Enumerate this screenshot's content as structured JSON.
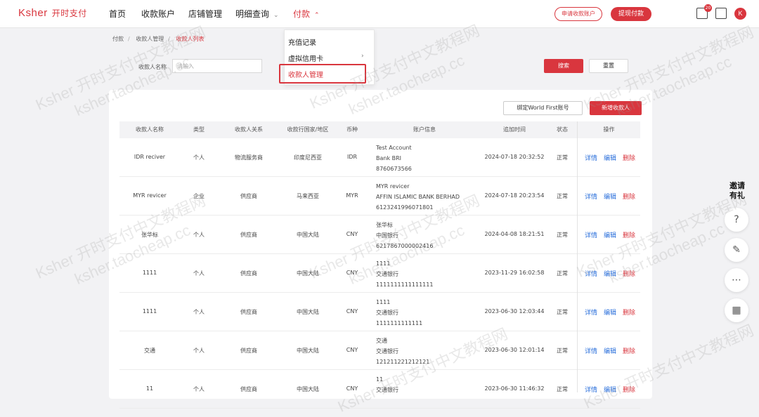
{
  "header": {
    "logo_text": "Ksher",
    "logo_cn": "开时支付",
    "nav": [
      "首页",
      "收款账户",
      "店铺管理",
      "明细查询",
      "付款"
    ],
    "apply_button": "申请收款账户",
    "withdraw_button": "提现付款",
    "badge_count": "20",
    "avatar_letter": "K"
  },
  "dropdown": {
    "items": [
      "充值记录",
      "虚拟信用卡",
      "收款人管理"
    ]
  },
  "breadcrumb": [
    "付款",
    "收款人管理",
    "收款人列表"
  ],
  "search": {
    "label": "收款人名称",
    "placeholder": "请输入",
    "search_button": "搜索",
    "reset_button": "重置"
  },
  "actions": {
    "bind_button": "绑定World First账号",
    "add_button": "新增收款人"
  },
  "table": {
    "headers": [
      "收款人名称",
      "类型",
      "收款人关系",
      "收款行国家/地区",
      "币种",
      "账户信息",
      "追加时间",
      "状态",
      "操作"
    ],
    "rows": [
      {
        "name": "IDR reciver",
        "type": "个人",
        "relation": "物流服务商",
        "country": "印度尼西亚",
        "currency": "IDR",
        "account": [
          "Test Account",
          "Bank BRI",
          "8760673566"
        ],
        "time": "2024-07-18 20:32:52",
        "status": "正常"
      },
      {
        "name": "MYR revicer",
        "type": "企业",
        "relation": "供应商",
        "country": "马来西亚",
        "currency": "MYR",
        "account": [
          "MYR revicer",
          "AFFIN ISLAMIC BANK BERHAD",
          "6123241996071801"
        ],
        "time": "2024-07-18 20:23:54",
        "status": "正常"
      },
      {
        "name": "张华标",
        "type": "个人",
        "relation": "供应商",
        "country": "中国大陆",
        "currency": "CNY",
        "account": [
          "张华标",
          "中国银行",
          "6217867000002416"
        ],
        "time": "2024-04-08 18:21:51",
        "status": "正常"
      },
      {
        "name": "1111",
        "type": "个人",
        "relation": "供应商",
        "country": "中国大陆",
        "currency": "CNY",
        "account": [
          "1111",
          "交通银行",
          "1111111111111111"
        ],
        "time": "2023-11-29 16:02:58",
        "status": "正常"
      },
      {
        "name": "1111",
        "type": "个人",
        "relation": "供应商",
        "country": "中国大陆",
        "currency": "CNY",
        "account": [
          "1111",
          "交通银行",
          "1111111111111"
        ],
        "time": "2023-06-30 12:03:44",
        "status": "正常"
      },
      {
        "name": "交通",
        "type": "个人",
        "relation": "供应商",
        "country": "中国大陆",
        "currency": "CNY",
        "account": [
          "交通",
          "交通银行",
          "121211221212121"
        ],
        "time": "2023-06-30 12:01:14",
        "status": "正常"
      },
      {
        "name": "11",
        "type": "个人",
        "relation": "供应商",
        "country": "中国大陆",
        "currency": "CNY",
        "account": [
          "11",
          "交通银行",
          ""
        ],
        "time": "2023-06-30 11:46:32",
        "status": "正常"
      }
    ],
    "ops": [
      "详情",
      "编辑",
      "删除"
    ]
  },
  "sidebar": {
    "invite_text": "邀请有礼"
  },
  "watermarks": [
    "Ksher 开时支付中文教程网",
    "ksher.taocheap.cc"
  ]
}
